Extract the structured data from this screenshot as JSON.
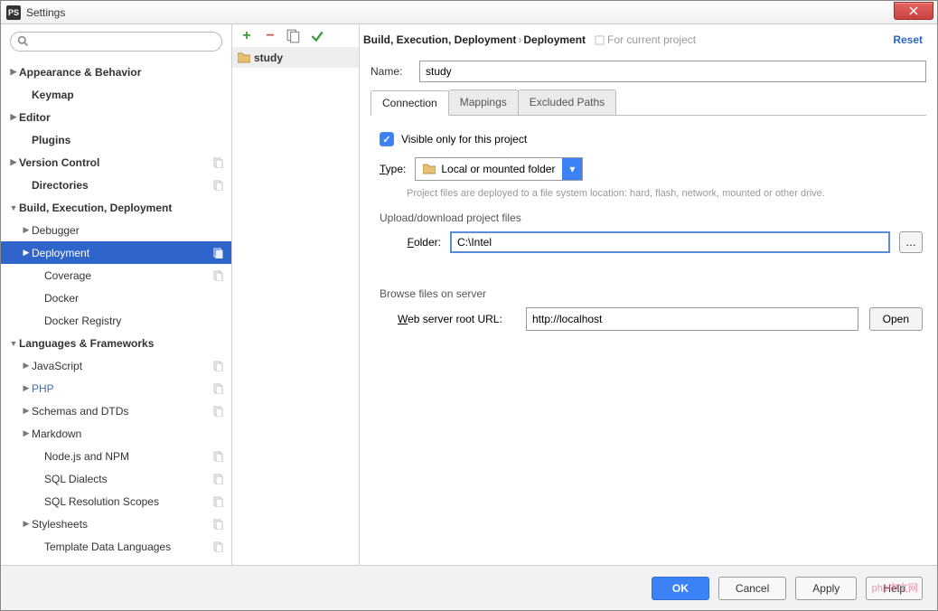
{
  "window": {
    "title": "Settings"
  },
  "sidebar": {
    "search_placeholder": "",
    "items": [
      {
        "label": "Appearance & Behavior",
        "bold": true,
        "arrow": "▶",
        "indent": 0
      },
      {
        "label": "Keymap",
        "bold": true,
        "indent": 1
      },
      {
        "label": "Editor",
        "bold": true,
        "arrow": "▶",
        "indent": 0
      },
      {
        "label": "Plugins",
        "bold": true,
        "indent": 1
      },
      {
        "label": "Version Control",
        "bold": true,
        "arrow": "▶",
        "indent": 0,
        "badge": true
      },
      {
        "label": "Directories",
        "bold": true,
        "indent": 1,
        "badge": true
      },
      {
        "label": "Build, Execution, Deployment",
        "bold": true,
        "arrow": "▼",
        "indent": 0
      },
      {
        "label": "Debugger",
        "arrow": "▶",
        "indent": 1
      },
      {
        "label": "Deployment",
        "arrow": "▶",
        "indent": 1,
        "sel": true,
        "badge": true
      },
      {
        "label": "Coverage",
        "indent": 2,
        "badge": true
      },
      {
        "label": "Docker",
        "indent": 2
      },
      {
        "label": "Docker Registry",
        "indent": 2
      },
      {
        "label": "Languages & Frameworks",
        "bold": true,
        "arrow": "▼",
        "indent": 0
      },
      {
        "label": "JavaScript",
        "arrow": "▶",
        "indent": 1,
        "badge": true
      },
      {
        "label": "PHP",
        "arrow": "▶",
        "indent": 1,
        "badge": true,
        "php": true
      },
      {
        "label": "Schemas and DTDs",
        "arrow": "▶",
        "indent": 1,
        "badge": true
      },
      {
        "label": "Markdown",
        "arrow": "▶",
        "indent": 1
      },
      {
        "label": "Node.js and NPM",
        "indent": 2,
        "badge": true
      },
      {
        "label": "SQL Dialects",
        "indent": 2,
        "badge": true
      },
      {
        "label": "SQL Resolution Scopes",
        "indent": 2,
        "badge": true
      },
      {
        "label": "Stylesheets",
        "arrow": "▶",
        "indent": 1,
        "badge": true
      },
      {
        "label": "Template Data Languages",
        "indent": 2,
        "badge": true
      }
    ]
  },
  "midlist": {
    "items": [
      {
        "label": "study"
      }
    ]
  },
  "header": {
    "crumb1": "Build, Execution, Deployment",
    "crumb2": "Deployment",
    "for_project": "For current project",
    "reset": "Reset"
  },
  "form": {
    "name_label": "Name:",
    "name_value": "study",
    "tabs": [
      "Connection",
      "Mappings",
      "Excluded Paths"
    ],
    "active_tab": 0,
    "visible_only": "Visible only for this project",
    "type_label": "Type:",
    "type_value": "Local or mounted folder",
    "type_hint": "Project files are deployed to a file system location: hard, flash, network, mounted or other drive.",
    "upload_section": "Upload/download project files",
    "folder_label": "Folder:",
    "folder_value": "C:\\Intel",
    "browse_section": "Browse files on server",
    "url_label": "Web server root URL:",
    "url_value": "http://localhost",
    "open": "Open"
  },
  "footer": {
    "ok": "OK",
    "cancel": "Cancel",
    "apply": "Apply",
    "help": "Help"
  },
  "watermark": "php中文网"
}
